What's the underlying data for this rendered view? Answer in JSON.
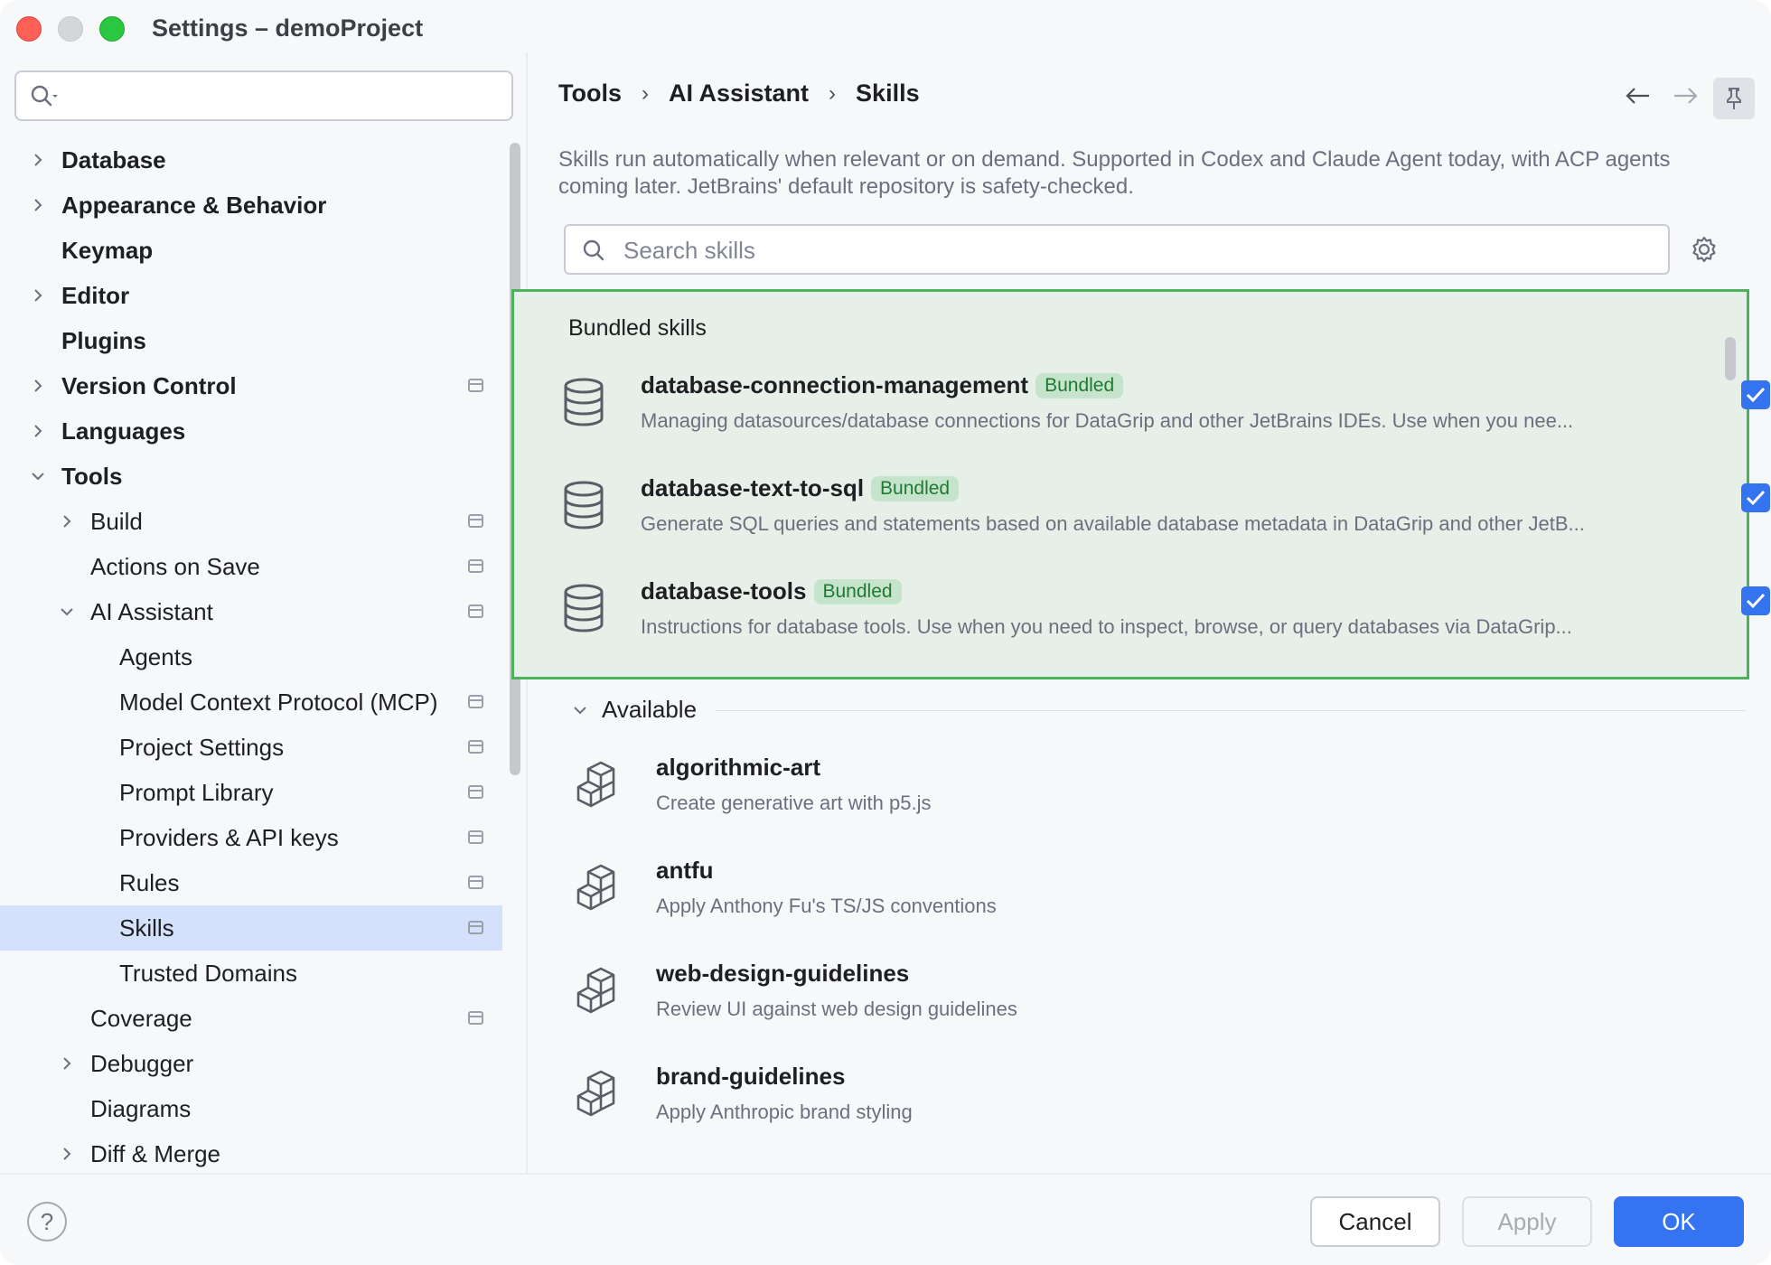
{
  "window": {
    "title": "Settings – demoProject"
  },
  "sidebar": {
    "search": {
      "placeholder": ""
    },
    "items": [
      {
        "label": "Database"
      },
      {
        "label": "Appearance & Behavior"
      },
      {
        "label": "Keymap"
      },
      {
        "label": "Editor"
      },
      {
        "label": "Plugins"
      },
      {
        "label": "Version Control"
      },
      {
        "label": "Languages"
      },
      {
        "label": "Tools"
      },
      {
        "label": "Build"
      },
      {
        "label": "Actions on Save"
      },
      {
        "label": "AI Assistant"
      },
      {
        "label": "Agents"
      },
      {
        "label": "Model Context Protocol (MCP)"
      },
      {
        "label": "Project Settings"
      },
      {
        "label": "Prompt Library"
      },
      {
        "label": "Providers & API keys"
      },
      {
        "label": "Rules"
      },
      {
        "label": "Skills"
      },
      {
        "label": "Trusted Domains"
      },
      {
        "label": "Coverage"
      },
      {
        "label": "Debugger"
      },
      {
        "label": "Diagrams"
      },
      {
        "label": "Diff & Merge"
      }
    ],
    "selected": "Skills"
  },
  "breadcrumb": [
    "Tools",
    "AI Assistant",
    "Skills"
  ],
  "description": "Skills run automatically when relevant or on demand. Supported in Codex and Claude Agent today, with ACP agents coming later. JetBrains' default repository is safety-checked.",
  "skills_search": {
    "placeholder": "Search skills",
    "value": ""
  },
  "bundled": {
    "title": "Bundled skills",
    "badge_label": "Bundled",
    "skills": [
      {
        "name": "database-connection-management",
        "description": "Managing datasources/database connections for DataGrip and other JetBrains IDEs. Use when you nee...",
        "enabled": true,
        "icon": "database-icon"
      },
      {
        "name": "database-text-to-sql",
        "description": "Generate SQL queries and statements based on available database metadata in DataGrip and other JetB...",
        "enabled": true,
        "icon": "database-icon"
      },
      {
        "name": "database-tools",
        "description": "Instructions for database tools. Use when you need to inspect, browse, or query databases via DataGrip...",
        "enabled": true,
        "icon": "database-icon"
      }
    ]
  },
  "available": {
    "title": "Available",
    "skills": [
      {
        "name": "algorithmic-art",
        "description": "Create generative art with p5.js",
        "icon": "blocks-icon"
      },
      {
        "name": "antfu",
        "description": "Apply Anthony Fu's TS/JS conventions",
        "icon": "blocks-icon"
      },
      {
        "name": "web-design-guidelines",
        "description": "Review UI against web design guidelines",
        "icon": "blocks-icon"
      },
      {
        "name": "brand-guidelines",
        "description": "Apply Anthropic brand styling",
        "icon": "blocks-icon"
      }
    ]
  },
  "footer": {
    "help": "?",
    "cancel": "Cancel",
    "apply": "Apply",
    "ok": "OK"
  },
  "colors": {
    "accent": "#3574f0",
    "selection": "#d5e1fb",
    "bundled_bg": "#e6efe8",
    "bundled_border": "#4cb05c",
    "badge_bg": "#c6e4cc",
    "badge_text": "#1f7a32"
  }
}
